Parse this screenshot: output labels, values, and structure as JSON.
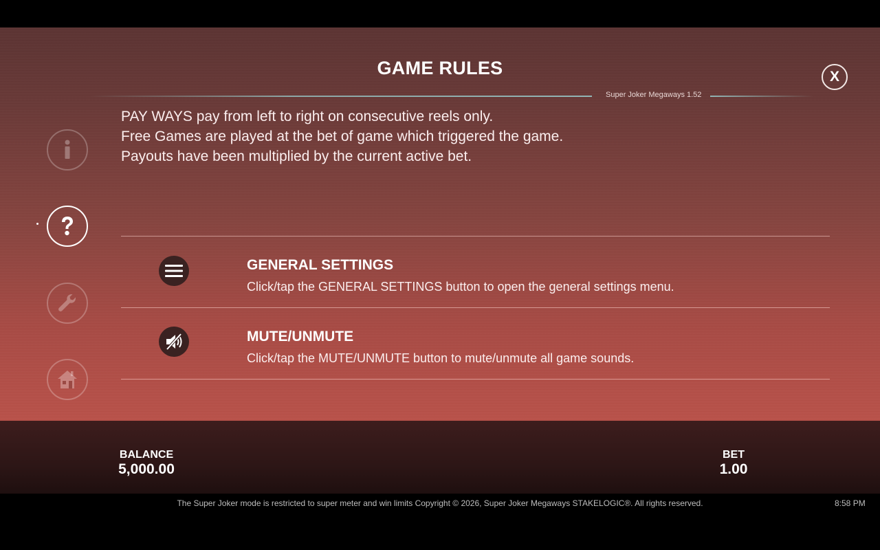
{
  "header": {
    "title": "GAME RULES",
    "version": "Super Joker Megaways 1.52",
    "close_label": "X"
  },
  "sidebar": {
    "items": [
      {
        "name": "info",
        "icon": "info-icon",
        "active": false
      },
      {
        "name": "help",
        "icon": "question-icon",
        "active": true
      },
      {
        "name": "settings",
        "icon": "wrench-icon",
        "active": false
      },
      {
        "name": "home",
        "icon": "home-icon",
        "active": false
      }
    ]
  },
  "rules": {
    "lines": [
      "PAY WAYS pay from left to right on consecutive reels only.",
      "Free Games are played at the bet of game which triggered the game.",
      "Payouts have been multiplied by the current active bet."
    ]
  },
  "settings": [
    {
      "icon": "hamburger-menu-icon",
      "title": "GENERAL SETTINGS",
      "description": "Click/tap the GENERAL SETTINGS button to open the general settings menu."
    },
    {
      "icon": "speaker-muted-icon",
      "title": "MUTE/UNMUTE",
      "description": "Click/tap the MUTE/UNMUTE button to mute/unmute all game sounds."
    }
  ],
  "footer": {
    "balance_label": "BALANCE",
    "balance_value": "5,000.00",
    "bet_label": "BET",
    "bet_value": "1.00",
    "copyright": "The Super Joker mode is restricted to super meter and win limits Copyright © 2026, Super Joker Megaways STAKELOGIC®. All rights reserved.",
    "clock": "8:58 PM"
  },
  "colors": {
    "panel_top": "#5c3433",
    "panel_bottom": "#b9524a",
    "footer_bg": "#2d1616",
    "icon_bg": "#3a2221",
    "divider_accent": "#96c3c3"
  }
}
